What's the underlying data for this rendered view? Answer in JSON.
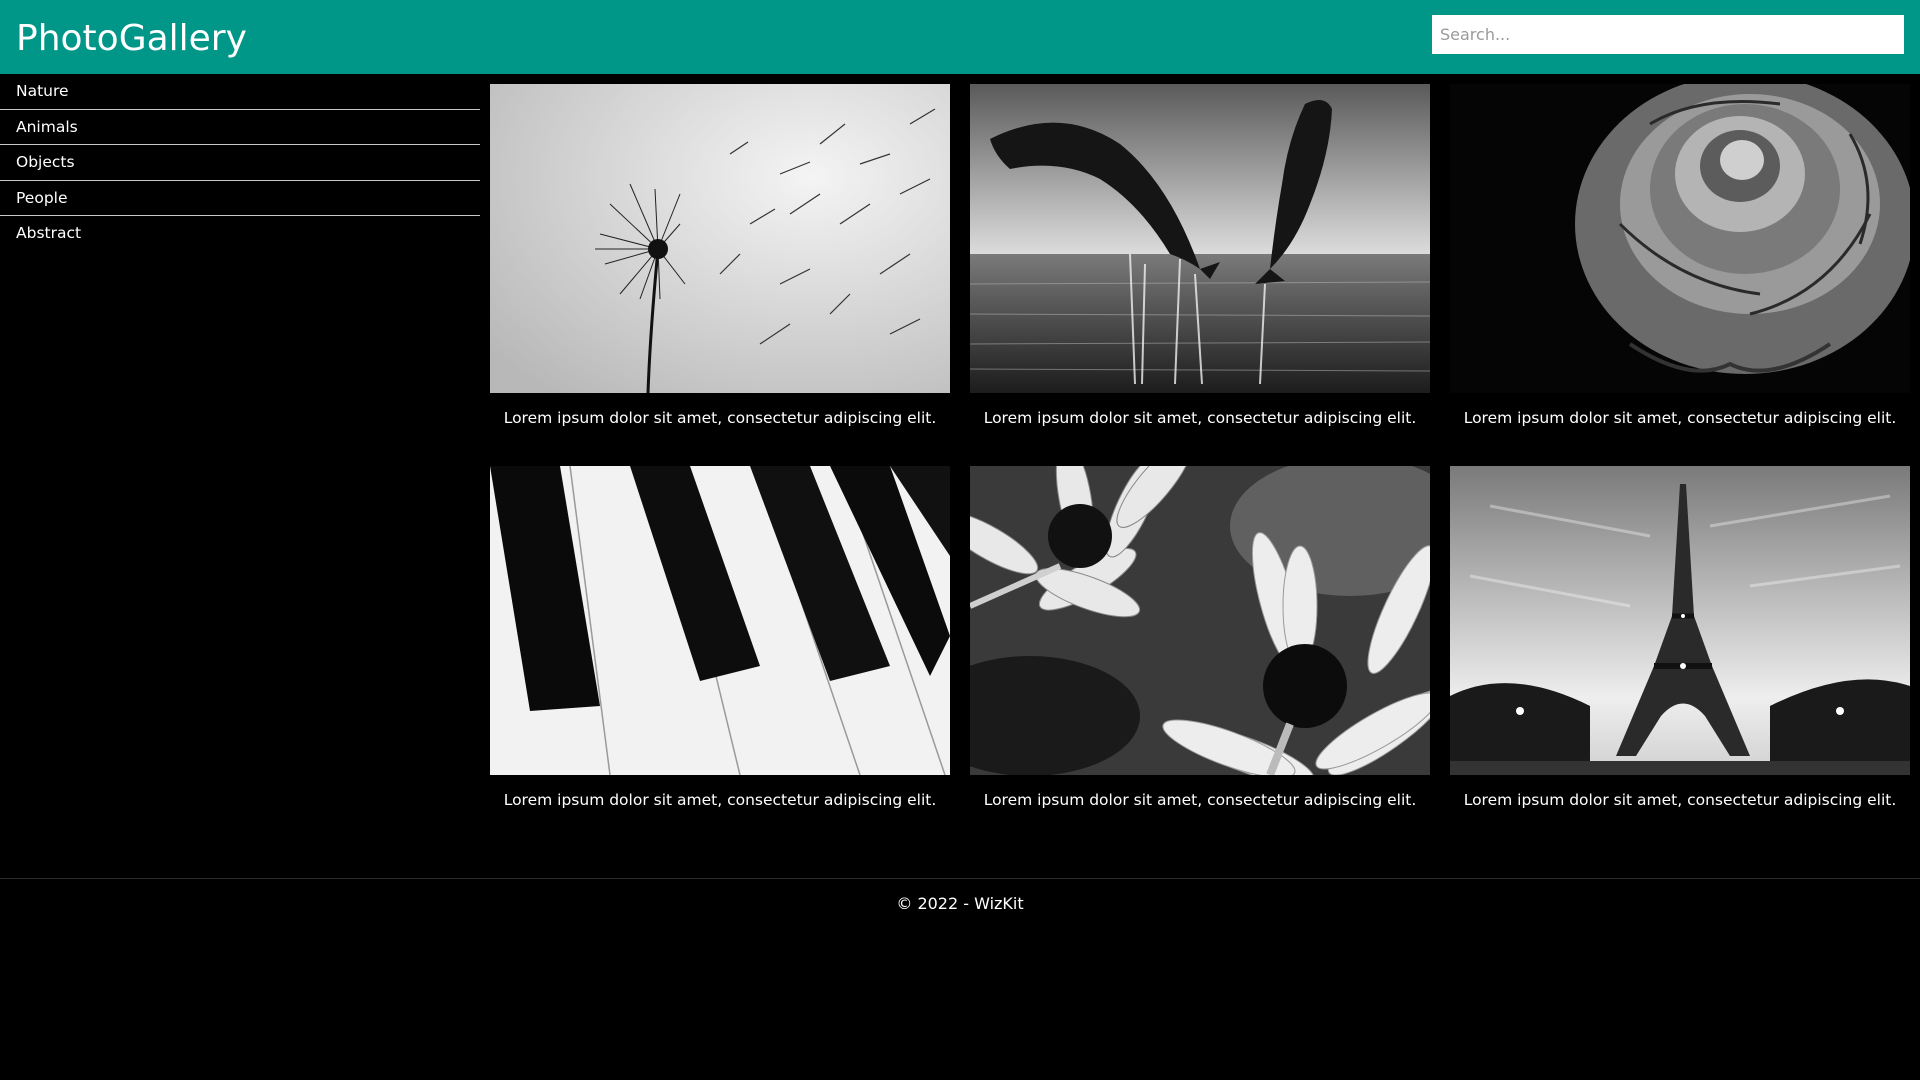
{
  "header": {
    "title": "PhotoGallery",
    "search_placeholder": "Search...",
    "search_value": ""
  },
  "sidebar": {
    "items": [
      {
        "label": "Nature"
      },
      {
        "label": "Animals"
      },
      {
        "label": "Objects"
      },
      {
        "label": "People"
      },
      {
        "label": "Abstract"
      }
    ]
  },
  "gallery": {
    "cards": [
      {
        "image": "dandelion-photo",
        "caption": "Lorem ipsum dolor sit amet, consectetur adipiscing elit."
      },
      {
        "image": "dolphins-photo",
        "caption": "Lorem ipsum dolor sit amet, consectetur adipiscing elit."
      },
      {
        "image": "rose-photo",
        "caption": "Lorem ipsum dolor sit amet, consectetur adipiscing elit."
      },
      {
        "image": "piano-keys-photo",
        "caption": "Lorem ipsum dolor sit amet, consectetur adipiscing elit."
      },
      {
        "image": "daisies-photo",
        "caption": "Lorem ipsum dolor sit amet, consectetur adipiscing elit."
      },
      {
        "image": "eiffel-tower-photo",
        "caption": "Lorem ipsum dolor sit amet, consectetur adipiscing elit."
      }
    ]
  },
  "footer": {
    "text": "© 2022 - WizKit"
  },
  "colors": {
    "header_bg": "#009688",
    "page_bg": "#000000",
    "text": "#ffffff"
  }
}
